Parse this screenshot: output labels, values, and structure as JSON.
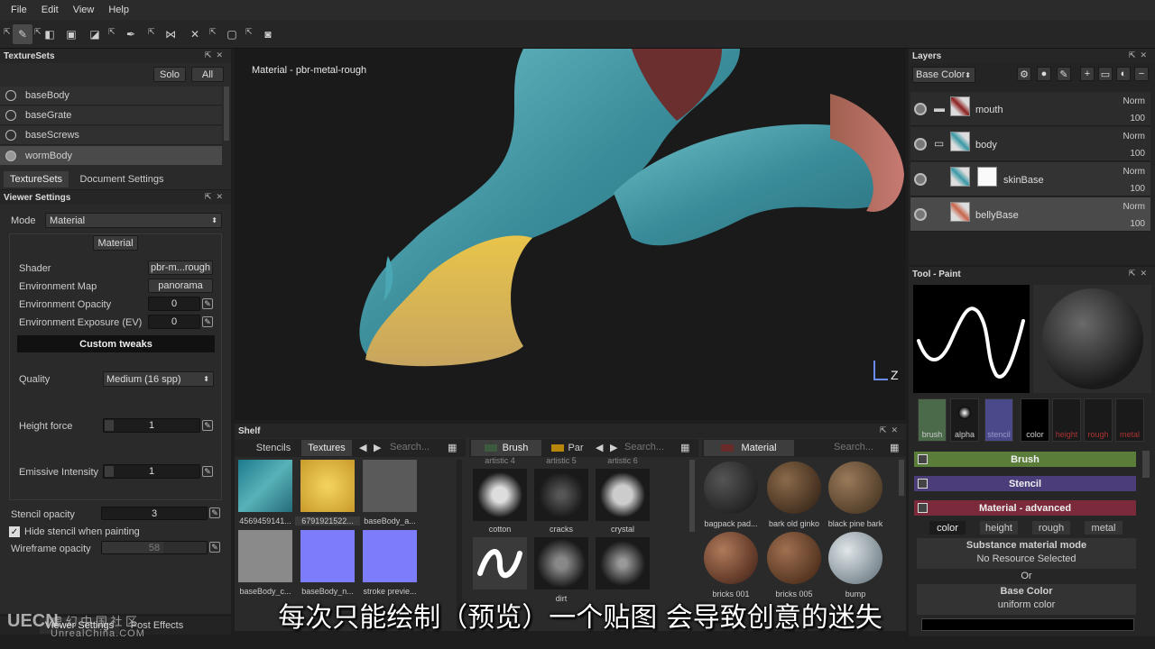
{
  "menu": [
    "File",
    "Edit",
    "View",
    "Help"
  ],
  "texturesets": {
    "title": "TextureSets",
    "solo": "Solo",
    "all": "All",
    "items": [
      "baseBody",
      "baseGrate",
      "baseScrews",
      "wormBody"
    ],
    "tabs": [
      "TextureSets",
      "Document Settings"
    ]
  },
  "viewer": {
    "title": "Viewer Settings",
    "mode_label": "Mode",
    "mode_value": "Material",
    "section": "Material",
    "shader_label": "Shader",
    "shader_value": "pbr-m...rough",
    "envmap_label": "Environment Map",
    "envmap_value": "panorama",
    "envop_label": "Environment Opacity",
    "envop_value": "0",
    "envexp_label": "Environment Exposure (EV)",
    "envexp_value": "0",
    "custom": "Custom tweaks",
    "quality_label": "Quality",
    "quality_value": "Medium (16 spp)",
    "height_label": "Height force",
    "height_value": "1",
    "emissive_label": "Emissive Intensity",
    "emissive_value": "1",
    "stencil_label": "Stencil opacity",
    "stencil_value": "3",
    "hide_stencil": "Hide stencil when painting",
    "wire_label": "Wireframe opacity",
    "wire_value": "58",
    "bottom_tabs": [
      "Viewer Settings",
      "Post Effects"
    ]
  },
  "viewport": {
    "label": "Material - pbr-metal-rough",
    "axis_z": "Z"
  },
  "layers": {
    "title": "Layers",
    "channel": "Base Color",
    "items": [
      {
        "name": "mouth",
        "blend": "Norm",
        "opacity": "100"
      },
      {
        "name": "body",
        "blend": "Norm",
        "opacity": "100"
      },
      {
        "name": "skinBase",
        "blend": "Norm",
        "opacity": "100"
      },
      {
        "name": "bellyBase",
        "blend": "Norm",
        "opacity": "100"
      }
    ]
  },
  "tool": {
    "title": "Tool - Paint",
    "channels": [
      "brush",
      "alpha",
      "stencil",
      "color",
      "height",
      "rough",
      "metal"
    ],
    "brush_bar": "Brush",
    "stencil_bar": "Stencil",
    "material_bar": "Material - advanced",
    "mat_tabs": [
      "color",
      "height",
      "rough",
      "metal"
    ],
    "subst_mode": "Substance material mode",
    "no_resource": "No Resource Selected",
    "or": "Or",
    "base_color": "Base Color",
    "uniform": "uniform color",
    "colors": {
      "brush": "#5a7d3a",
      "stencil": "#4a3d7a",
      "material": "#7a2a3a"
    }
  },
  "shelf": {
    "title": "Shelf",
    "tex_tabs": [
      "Stencils",
      "Textures"
    ],
    "search1": "Search...",
    "brush_tab": "Brush",
    "par_tab": "Par",
    "search2": "Search...",
    "material_tab": "Material",
    "search3": "Search...",
    "textures": [
      "4569459141...",
      "6791921522...",
      "baseBody_a...",
      "baseBody_c...",
      "baseBody_n...",
      "stroke previe..."
    ],
    "brushes_top": [
      "artistic 4",
      "artistic 5",
      "artistic 6"
    ],
    "brushes": [
      "cotton",
      "cracks",
      "crystal",
      "",
      "dirt",
      ""
    ],
    "materials": [
      "bagpack pad...",
      "bark old ginko",
      "black pine bark",
      "bricks 001",
      "bricks 005",
      "bump"
    ]
  },
  "overlay": {
    "subtitle": "每次只能绘制（预览）一个贴图 会导致创意的迷失",
    "wm_brand": "UECN",
    "wm_cn": "虚 幻 中 国 社 区",
    "wm_url": "UnrealChina.COM"
  }
}
